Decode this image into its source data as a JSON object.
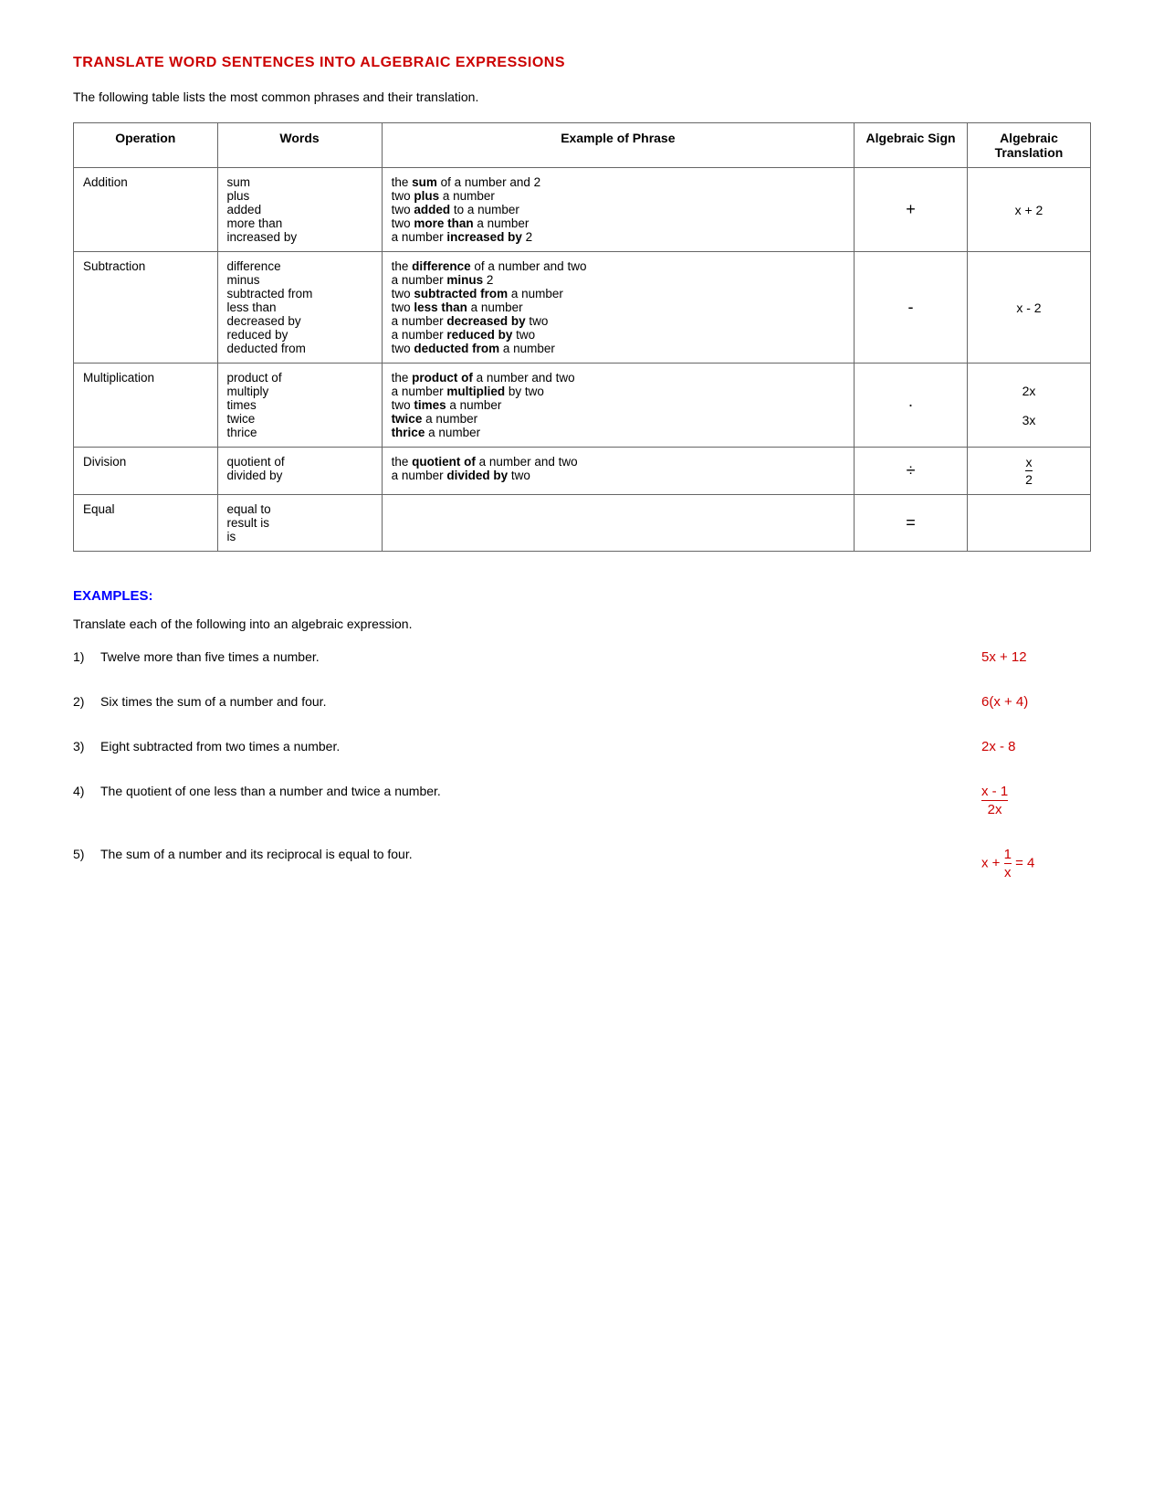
{
  "title": "TRANSLATE WORD SENTENCES INTO ALGEBRAIC EXPRESSIONS",
  "intro": "The following table lists the most common phrases and their translation.",
  "table": {
    "headers": [
      "Operation",
      "Words",
      "Example of Phrase",
      "Algebraic Sign",
      "Algebraic\nTranslation"
    ],
    "rows": [
      {
        "operation": "Addition",
        "words": [
          "sum",
          "plus",
          "added",
          "more than",
          "increased by"
        ],
        "examples": [
          {
            "text": "the ",
            "bold": "sum",
            "rest": " of a number and 2"
          },
          {
            "text": "two ",
            "bold": "plus",
            "rest": " a number"
          },
          {
            "text": "two ",
            "bold": "added",
            "rest": " to a number"
          },
          {
            "text": "two ",
            "bold": "more than",
            "rest": " a number"
          },
          {
            "text": "a number ",
            "bold": "increased by",
            "rest": " 2"
          }
        ],
        "sign": "+",
        "translation": "x + 2"
      },
      {
        "operation": "Subtraction",
        "words": [
          "difference",
          "minus",
          "subtracted from",
          "less than",
          "decreased by",
          "reduced by",
          "deducted from"
        ],
        "examples": [
          {
            "text": "the ",
            "bold": "difference",
            "rest": " of a number and two"
          },
          {
            "text": "a number ",
            "bold": "minus",
            "rest": " 2"
          },
          {
            "text": "two ",
            "bold": "subtracted from",
            "rest": " a number"
          },
          {
            "text": "two ",
            "bold": "less than",
            "rest": " a number"
          },
          {
            "text": "a number ",
            "bold": "decreased by",
            "rest": " two"
          },
          {
            "text": "a number ",
            "bold": "reduced by",
            "rest": " two"
          },
          {
            "text": "two ",
            "bold": "deducted from",
            "rest": " a number"
          }
        ],
        "sign": "-",
        "translation": "x - 2"
      },
      {
        "operation": "Multiplication",
        "words": [
          "product of",
          "multiply",
          "times",
          "twice",
          "thrice"
        ],
        "examples": [
          {
            "text": "the ",
            "bold": "product of",
            "rest": " a number and two"
          },
          {
            "text": "a number ",
            "bold": "multiplied",
            "rest": " by two"
          },
          {
            "text": "two ",
            "bold": "times",
            "rest": " a number"
          },
          {
            "text": "",
            "bold": "twice",
            "rest": " a number"
          },
          {
            "text": "",
            "bold": "thrice",
            "rest": " a number"
          }
        ],
        "sign": "·",
        "translation": "2x\n\n3x"
      },
      {
        "operation": "Division",
        "words": [
          "quotient of",
          "divided by"
        ],
        "examples": [
          {
            "text": "the ",
            "bold": "quotient of",
            "rest": " a number and two"
          },
          {
            "text": "a number ",
            "bold": "divided by",
            "rest": " two"
          }
        ],
        "sign": "÷",
        "translation": "x/2"
      },
      {
        "operation": "Equal",
        "words": [
          "equal to",
          "result is",
          "is"
        ],
        "examples": [],
        "sign": "=",
        "translation": ""
      }
    ]
  },
  "examples_title": "EXAMPLES:",
  "examples_intro": "Translate each of the following into an algebraic expression.",
  "examples": [
    {
      "num": "1)",
      "text": "Twelve more than five times a number.",
      "answer": "5x + 12",
      "type": "simple"
    },
    {
      "num": "2)",
      "text": "Six times the sum of a number and four.",
      "answer": "6(x + 4)",
      "type": "simple"
    },
    {
      "num": "3)",
      "text": "Eight subtracted from two times a number.",
      "answer": "2x - 8",
      "type": "simple"
    },
    {
      "num": "4)",
      "text": "The quotient of one less than a number and twice a number.",
      "answer_num": "x - 1",
      "answer_den": "2x",
      "type": "fraction"
    },
    {
      "num": "5)",
      "text": "The sum of  a number and its reciprocal is equal to four.",
      "answer_pre": "x + ",
      "answer_num": "1",
      "answer_den": "x",
      "answer_post": " = 4",
      "type": "fraction_inline"
    }
  ]
}
